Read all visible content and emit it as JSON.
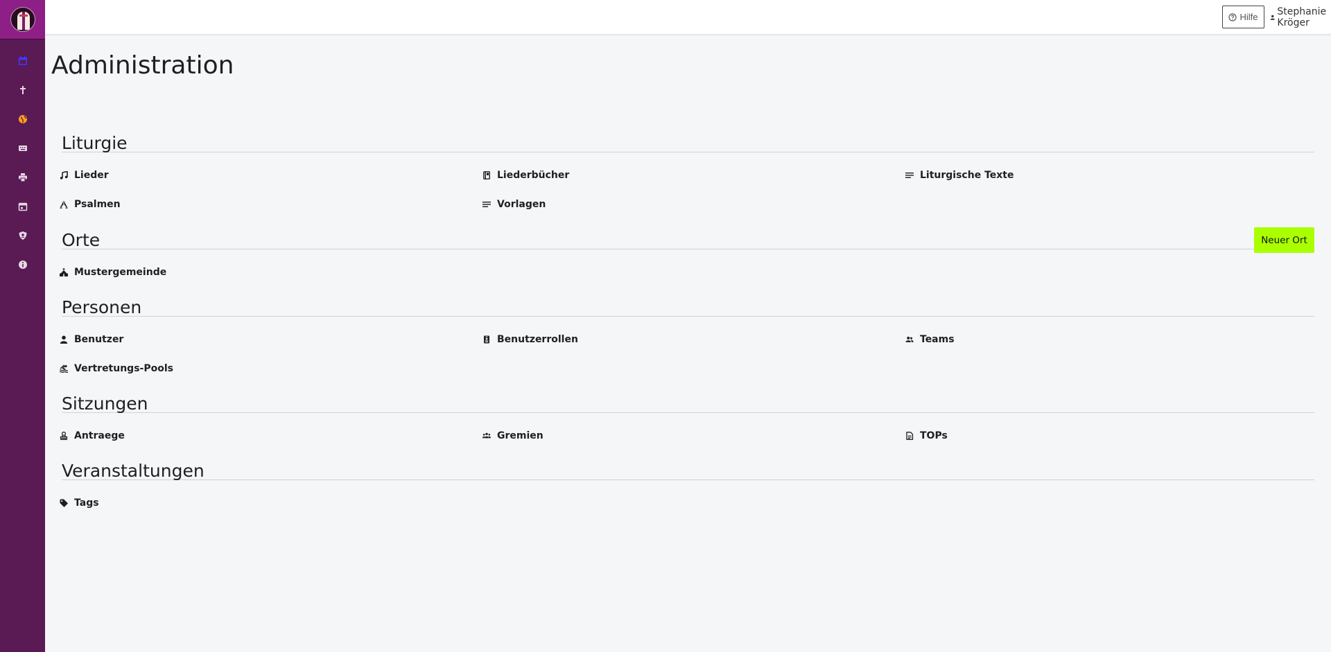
{
  "topbar": {
    "help_label": "Hilfe",
    "user_name": "Stephanie Kröger"
  },
  "sidebar": {
    "items": [
      {
        "icon": "calendar-icon",
        "color": "#3b3bff"
      },
      {
        "icon": "cross-icon",
        "color": "#e6d8e6"
      },
      {
        "icon": "globe-icon",
        "color": "#ff9f1a"
      },
      {
        "icon": "keyboard-icon",
        "color": "#e6d8e6"
      },
      {
        "icon": "printer-icon",
        "color": "#e6d8e6"
      },
      {
        "icon": "calendar-day-icon",
        "color": "#e6d8e6"
      },
      {
        "icon": "user-shield-icon",
        "color": "#e6d8e6"
      },
      {
        "icon": "info-icon",
        "color": "#e6d8e6"
      }
    ]
  },
  "page": {
    "title": "Administration"
  },
  "sections": {
    "liturgie": {
      "title": "Liturgie",
      "items": [
        {
          "label": "Lieder",
          "icon": "music-icon"
        },
        {
          "label": "Liederbücher",
          "icon": "book-icon"
        },
        {
          "label": "Liturgische Texte",
          "icon": "text-lines-icon"
        },
        {
          "label": "Psalmen",
          "icon": "praying-hands-icon"
        },
        {
          "label": "Vorlagen",
          "icon": "text-lines-icon"
        }
      ]
    },
    "orte": {
      "title": "Orte",
      "new_button": "Neuer Ort",
      "items": [
        {
          "label": "Mustergemeinde",
          "icon": "church-icon"
        }
      ]
    },
    "personen": {
      "title": "Personen",
      "items": [
        {
          "label": "Benutzer",
          "icon": "user-icon"
        },
        {
          "label": "Benutzerrollen",
          "icon": "id-badge-icon"
        },
        {
          "label": "Teams",
          "icon": "users-icon"
        },
        {
          "label": "Vertretungs-Pools",
          "icon": "swimmer-icon"
        }
      ]
    },
    "sitzungen": {
      "title": "Sitzungen",
      "items": [
        {
          "label": "Antraege",
          "icon": "stamp-icon"
        },
        {
          "label": "Gremien",
          "icon": "group-icon"
        },
        {
          "label": "TOPs",
          "icon": "file-text-icon"
        }
      ]
    },
    "veranstaltungen": {
      "title": "Veranstaltungen",
      "items": [
        {
          "label": "Tags",
          "icon": "tag-icon"
        }
      ]
    }
  }
}
